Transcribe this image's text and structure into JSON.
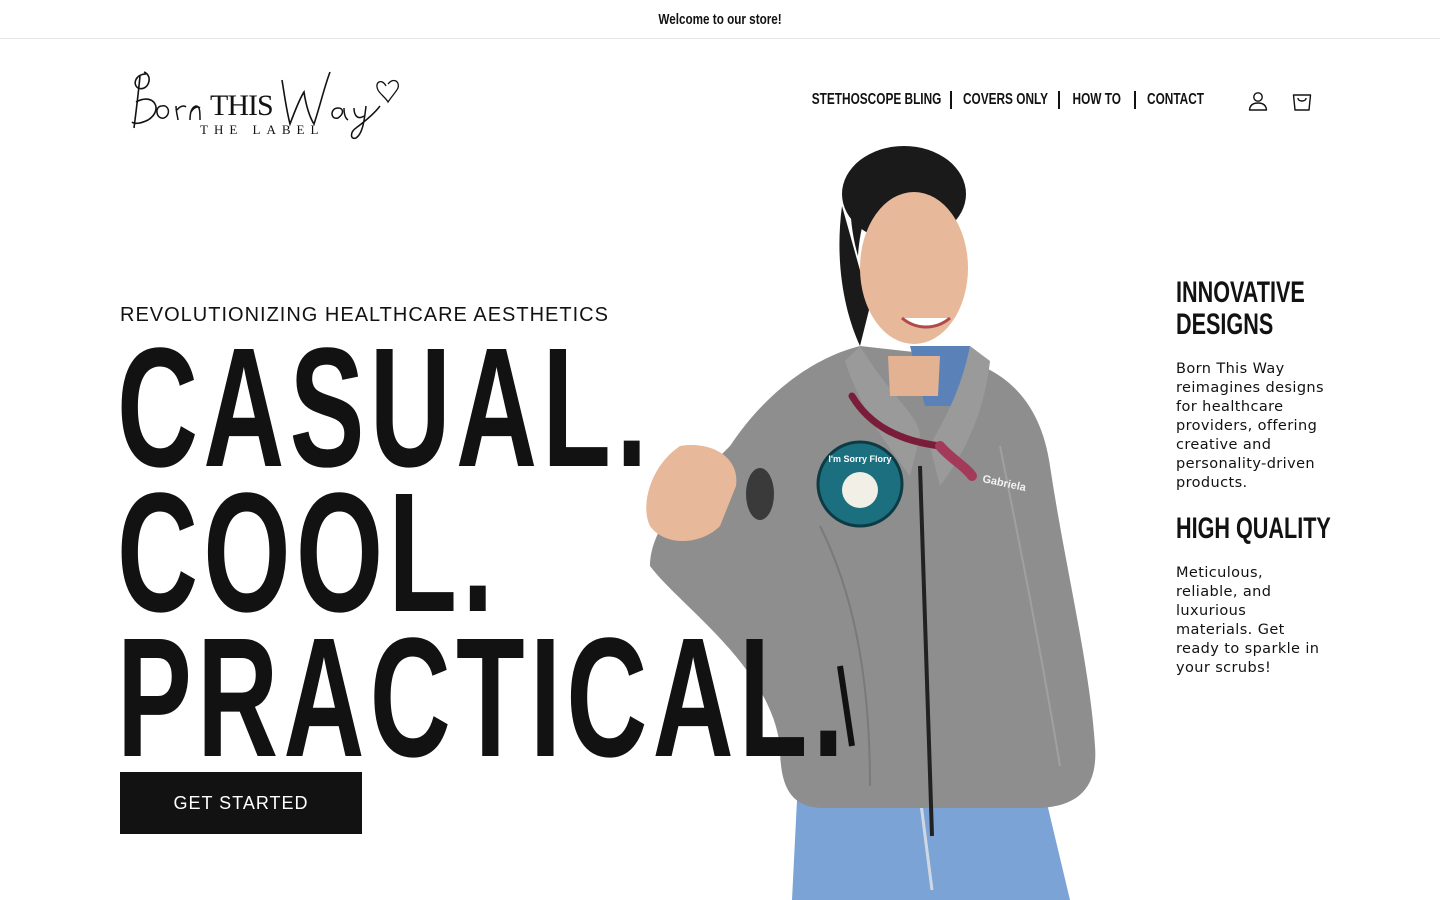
{
  "announcement": {
    "text": "Welcome to our store!"
  },
  "logo": {
    "script_text": "BornTHISWay",
    "sub_text": "THE LABEL"
  },
  "nav": {
    "items": [
      {
        "label": "STETHOSCOPE BLING"
      },
      {
        "label": "COVERS ONLY"
      },
      {
        "label": "HOW TO"
      },
      {
        "label": "CONTACT"
      }
    ]
  },
  "header_icons": {
    "account": "user-icon",
    "cart": "cart-icon"
  },
  "hero": {
    "eyebrow": "REVOLUTIONIZING HEALTHCARE AESTHETICS",
    "headline": [
      "CASUAL.",
      "COOL.",
      "PRACTICAL."
    ],
    "cta_label": "GET STARTED",
    "badge_text": "I'm Sorry Flory",
    "jacket_name": "Gabriela"
  },
  "features": [
    {
      "title_lines": [
        "INNOVATIVE",
        "DESIGNS"
      ],
      "body": "Born This Way reimagines designs for healthcare providers, offering creative and personality-driven products."
    },
    {
      "title_lines": [
        "HIGH QUALITY"
      ],
      "body": "Meticulous, reliable, and luxurious materials. Get ready to sparkle in your scrubs!"
    }
  ],
  "colors": {
    "text": "#121212",
    "button_bg": "#121212",
    "button_text": "#ffffff",
    "border": "#e6e6e6"
  }
}
